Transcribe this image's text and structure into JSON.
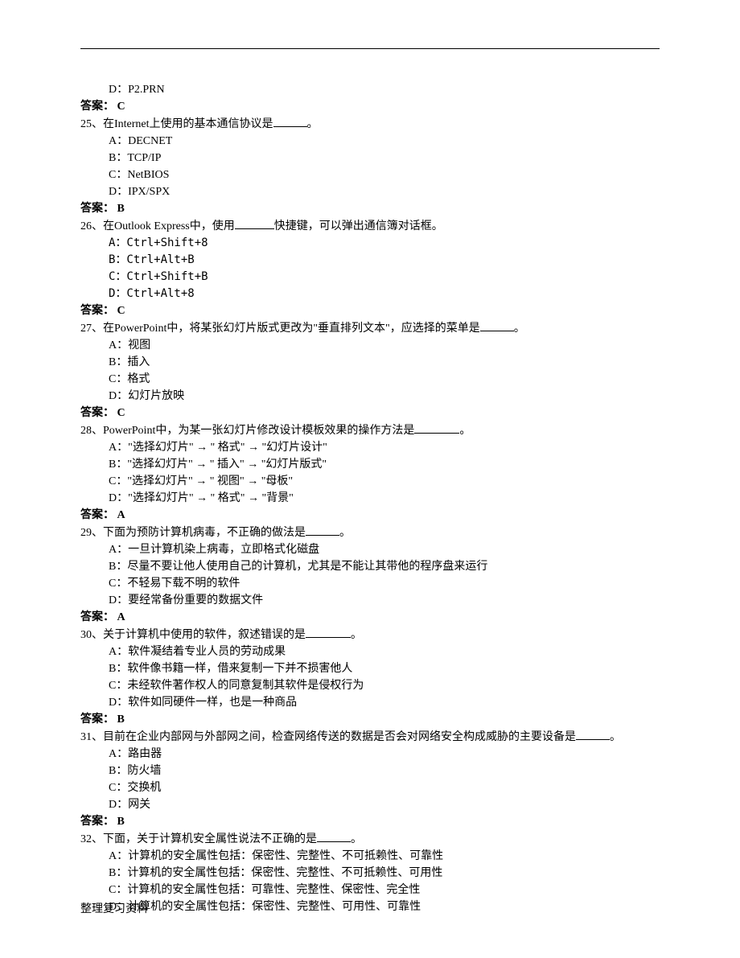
{
  "q24": {
    "optD": "D：P2.PRN",
    "answer": "答案：  C"
  },
  "q25": {
    "stem_a": "25、在Internet上使用的基本通信协议是",
    "stem_b": "。",
    "optA": "A：DECNET",
    "optB": "B：TCP/IP",
    "optC": "C：NetBIOS",
    "optD": "D：IPX/SPX",
    "answer": "答案：  B"
  },
  "q26": {
    "stem_a": "26、在Outlook Express中，使用",
    "stem_b": "快捷键，可以弹出通信簿对话框。",
    "optA": "A：Ctrl+Shift+8",
    "optB": "B：Ctrl+Alt+B",
    "optC": "C：Ctrl+Shift+B",
    "optD": "D：Ctrl+Alt+8",
    "answer": "答案：  C"
  },
  "q27": {
    "stem_a": "27、在PowerPoint中，将某张幻灯片版式更改为\"垂直排列文本\"，应选择的菜单是",
    "stem_b": "。",
    "optA": "A：视图",
    "optB": "B：插入",
    "optC": "C：格式",
    "optD": "D：幻灯片放映",
    "answer": "答案：  C"
  },
  "q28": {
    "stem_a": "28、PowerPoint中，为某一张幻灯片修改设计模板效果的操作方法是",
    "stem_b": "。",
    "optA": "A：\"选择幻灯片\" → \" 格式\" → \"幻灯片设计\"",
    "optB": "B：\"选择幻灯片\" → \" 插入\" → \"幻灯片版式\"",
    "optC": "C：\"选择幻灯片\" → \" 视图\" → \"母板\"",
    "optD": "D：\"选择幻灯片\" → \" 格式\" → \"背景\"",
    "answer": "答案：  A"
  },
  "q29": {
    "stem_a": "29、下面为预防计算机病毒，不正确的做法是",
    "stem_b": "。",
    "optA": "A：一旦计算机染上病毒，立即格式化磁盘",
    "optB": "B：尽量不要让他人使用自己的计算机，尤其是不能让其带他的程序盘来运行",
    "optC": "C：不轻易下载不明的软件",
    "optD": "D：要经常备份重要的数据文件",
    "answer": "答案：  A"
  },
  "q30": {
    "stem_a": "30、关于计算机中使用的软件，叙述错误的是",
    "stem_b": "。",
    "optA": "A：软件凝结着专业人员的劳动成果",
    "optB": "B：软件像书籍一样，借来复制一下并不损害他人",
    "optC": "C：未经软件著作权人的同意复制其软件是侵权行为",
    "optD": "D：软件如同硬件一样，也是一种商品",
    "answer": "答案：  B"
  },
  "q31": {
    "stem_a": "31、目前在企业内部网与外部网之间，检查网络传送的数据是否会对网络安全构成威胁的主要设备是",
    "stem_b": "。",
    "optA": "A：路由器",
    "optB": "B：防火墙",
    "optC": "C：交换机",
    "optD": "D：网关",
    "answer": "答案：  B"
  },
  "q32": {
    "stem_a": "32、下面，关于计算机安全属性说法不正确的是",
    "stem_b": "。",
    "optA": "A：计算机的安全属性包括：保密性、完整性、不可抵赖性、可靠性",
    "optB": "B：计算机的安全属性包括：保密性、完整性、不可抵赖性、可用性",
    "optC": "C：计算机的安全属性包括：可靠性、完整性、保密性、完全性",
    "optD": "D：计算机的安全属性包括：保密性、完整性、可用性、可靠性"
  },
  "footer": "整理复习资料"
}
